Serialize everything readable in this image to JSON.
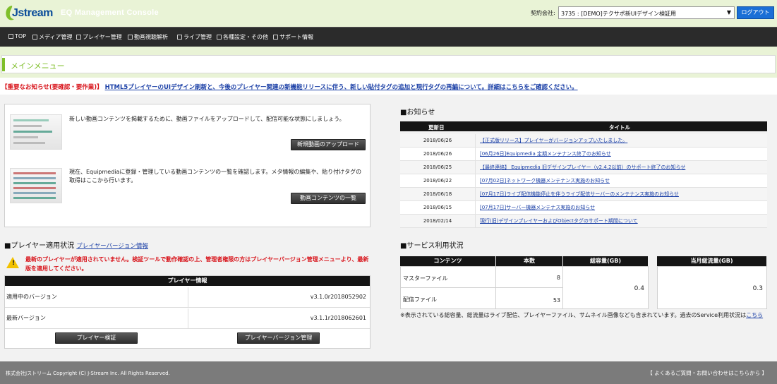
{
  "header": {
    "logo_text": "Jstream",
    "app_title": "EQ Management Console",
    "contract_label": "契約会社:",
    "contract_value": "3735 : [DEMO]テクサポ新UIデザイン検証用",
    "logout_label": "ログアウト"
  },
  "nav": {
    "items": [
      "TOP",
      "メディア管理",
      "プレイヤー管理",
      "動画視聴解析",
      "ライブ管理",
      "各種設定・その他",
      "サポート情報"
    ]
  },
  "main_menu": {
    "title": "メインメニュー"
  },
  "notice": {
    "prefix": "【重要なお知らせ(要確認・要作業)】",
    "link": "HTML5プレイヤーのUIデザイン刷新と、今後のプレイヤー関連の新機能リリースに伴う、新しい貼付タグの追加と現行タグの再編について。詳細はこちらをご確認ください。"
  },
  "upload": {
    "text": "新しい動画コンテンツを掲載するために、動画ファイルをアップロードして、配信可能な状態にしましょう。",
    "button": "新規動画のアップロード"
  },
  "contents": {
    "text": "現在、Equipmediaに登録・管理している動画コンテンツの一覧を確認します。メタ情報の編集や、貼り付けタグの取得はここから行います。",
    "button": "動画コンテンツの一覧"
  },
  "player_status": {
    "title": "■プレイヤー適用状況",
    "link": "プレイヤーバージョン情報",
    "warning": "最新のプレイヤーが適用されていません。検証ツールで動作確認の上、管理者権限の方はプレイヤーバージョン管理メニューより、最新版を適用してください。",
    "table_header": "プレイヤー情報",
    "rows": [
      {
        "key": "適用中のバージョン",
        "value": "v3.1.0r2018052902"
      },
      {
        "key": "最新バージョン",
        "value": "v3.1.1r2018062601"
      }
    ],
    "verify_button": "プレイヤー検証",
    "manage_button": "プレイヤーバージョン管理"
  },
  "news": {
    "title": "■お知らせ",
    "col_date": "更新日",
    "col_title": "タイトル",
    "items": [
      {
        "date": "2018/06/26",
        "title": "【正式版リリース】プレイヤーがバージョンアップいたしました。"
      },
      {
        "date": "2018/06/26",
        "title": "[06月26日]Equipmedia 定期メンテナンス終了のお知らせ"
      },
      {
        "date": "2018/06/25",
        "title": "【最終連絡】 Equipmedia 旧デザインプレイヤー（v2.4.2以前）のサポート終了のお知らせ"
      },
      {
        "date": "2018/06/22",
        "title": "[07月02日]ネットワーク機器メンテナンス実施のお知らせ"
      },
      {
        "date": "2018/06/18",
        "title": "[07月17日]ライブ配信機能停止を伴うライブ配信サーバーのメンテナンス実施のお知らせ"
      },
      {
        "date": "2018/06/15",
        "title": "[07月17日]サーバー機器メンテナス実施のお知らせ"
      },
      {
        "date": "2018/02/14",
        "title": "現行(旧)デザインプレイヤーおよびObjectタグのサポート期間について"
      }
    ]
  },
  "service": {
    "title": "■サービス利用状況",
    "col_contents": "コンテンツ",
    "col_count": "本数",
    "col_total": "総容量(GB)",
    "col_monthly": "当月総流量(GB)",
    "rows": [
      {
        "name": "マスターファイル",
        "count": "8"
      },
      {
        "name": "配信ファイル",
        "count": "53"
      }
    ],
    "total_gb": "0.4",
    "monthly_gb": "0.3",
    "note": "※表示されている総容量、総流量はライブ配信、プレイヤーファイル、サムネイル画像なども含まれています。過去のService利用状況は",
    "note_link": "こちら"
  },
  "footer": {
    "copyright": "株式会社Jストリーム  Copyright (C) J-Stream Inc. All Rights Reserved.",
    "contact": "【 よくあるご質問・お問い合わせはこちらから 】"
  }
}
